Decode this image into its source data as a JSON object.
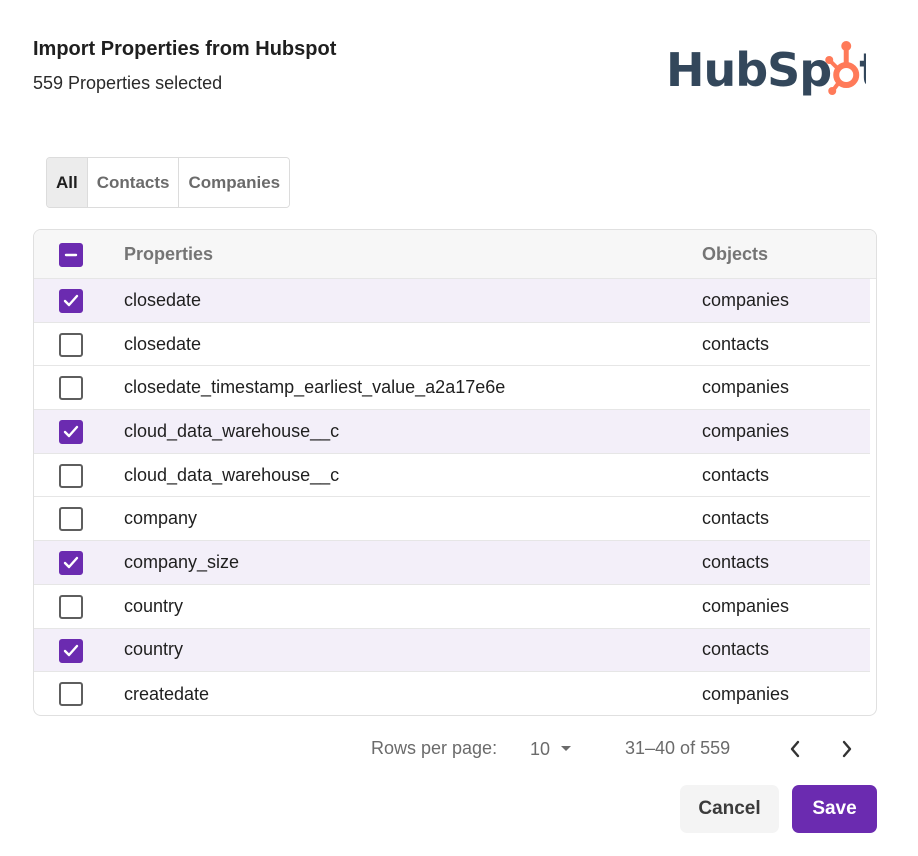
{
  "dialog": {
    "title": "Import Properties from Hubspot",
    "subtitle": "559 Properties selected"
  },
  "logo": {
    "icon": "hubspot-logo",
    "text_left": "HubSp",
    "text_right": "t",
    "brand_color": "#33475b",
    "sprocket_color": "#ff7a59"
  },
  "tabs": [
    {
      "label": "All",
      "active": true
    },
    {
      "label": "Contacts",
      "active": false
    },
    {
      "label": "Companies",
      "active": false
    }
  ],
  "table": {
    "header_checkbox_state": "indeterminate",
    "columns": {
      "properties": "Properties",
      "objects": "Objects"
    },
    "rows": [
      {
        "property": "closedate",
        "object": "companies",
        "checked": true
      },
      {
        "property": "closedate",
        "object": "contacts",
        "checked": false
      },
      {
        "property": "closedate_timestamp_earliest_value_a2a17e6e",
        "object": "companies",
        "checked": false
      },
      {
        "property": "cloud_data_warehouse__c",
        "object": "companies",
        "checked": true
      },
      {
        "property": "cloud_data_warehouse__c",
        "object": "contacts",
        "checked": false
      },
      {
        "property": "company",
        "object": "contacts",
        "checked": false
      },
      {
        "property": "company_size",
        "object": "contacts",
        "checked": true
      },
      {
        "property": "country",
        "object": "companies",
        "checked": false
      },
      {
        "property": "country",
        "object": "contacts",
        "checked": true
      },
      {
        "property": "createdate",
        "object": "companies",
        "checked": false
      }
    ]
  },
  "pagination": {
    "rows_per_page_label": "Rows per page:",
    "rows_per_page_value": "10",
    "range_label": "31–40 of 559",
    "prev_icon": "chevron-left-icon",
    "next_icon": "chevron-right-icon"
  },
  "actions": {
    "cancel_label": "Cancel",
    "save_label": "Save"
  },
  "colors": {
    "accent": "#6b2bb0",
    "selected_row": "#f3eff9"
  }
}
